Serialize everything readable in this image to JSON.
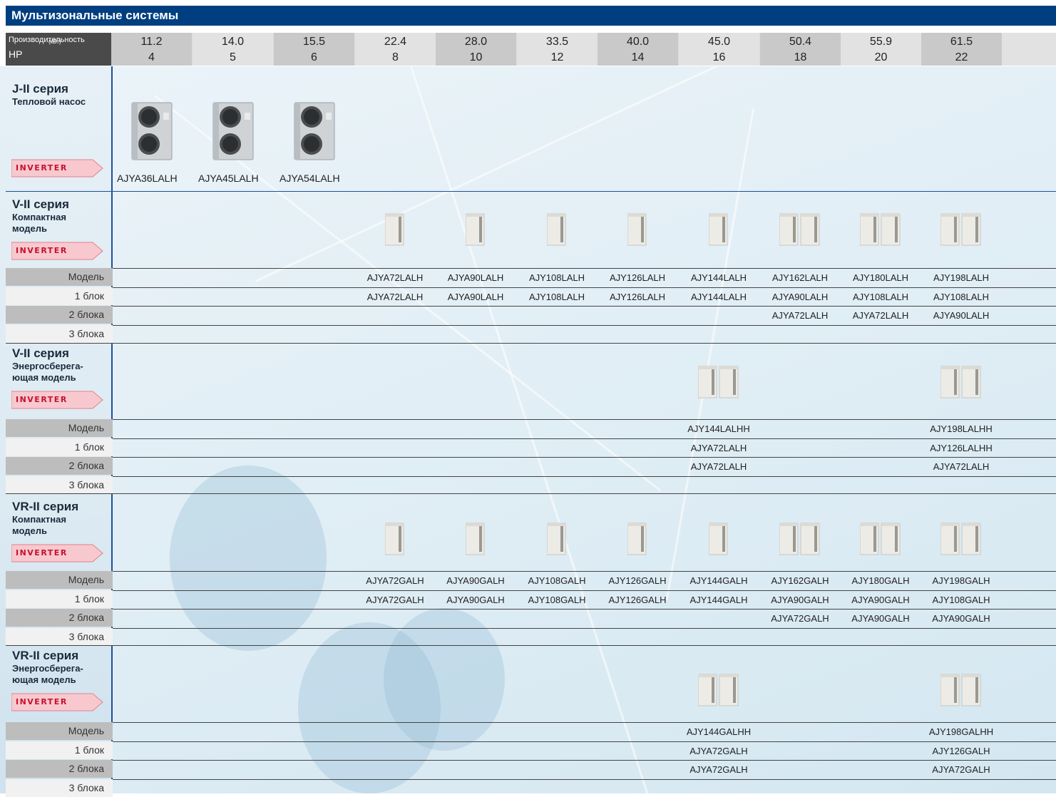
{
  "title": "Мультизональные системы",
  "header": {
    "capacity_label": "Производительность",
    "capacity_unit": "(кВт)",
    "hp_label": "HP",
    "capacity": [
      "11.2",
      "14.0",
      "15.5",
      "22.4",
      "28.0",
      "33.5",
      "40.0",
      "45.0",
      "50.4",
      "55.9",
      "61.5"
    ],
    "hp": [
      "4",
      "5",
      "6",
      "8",
      "10",
      "12",
      "14",
      "16",
      "18",
      "20",
      "22"
    ]
  },
  "colors": {
    "title_bar": "#003f7f",
    "inverter_badge": "#f7c9cf",
    "inverter_text": "#c8102e",
    "divider": "#1f4f99"
  },
  "badge": "INVERTER",
  "row_labels": {
    "model": "Модель",
    "block1": "1 блок",
    "block2": "2 блока",
    "block3": "3 блока"
  },
  "series": [
    {
      "name": "J-II серия",
      "sub1": "Тепловой насос",
      "sub2": "",
      "models": [
        "AJYA36LALH",
        "AJYA45LALH",
        "AJYA54LALH"
      ]
    },
    {
      "name": "V-II серия",
      "sub1": "Компактная",
      "sub2": "модель",
      "model": [
        "",
        "",
        "",
        "AJYA72LALH",
        "AJYA90LALH",
        "AJY108LALH",
        "AJY126LALH",
        "AJY144LALH",
        "AJY162LALH",
        "AJY180LALH",
        "AJY198LALH"
      ],
      "block1": [
        "",
        "",
        "",
        "AJYA72LALH",
        "AJYA90LALH",
        "AJY108LALH",
        "AJY126LALH",
        "AJY144LALH",
        "AJYA90LALH",
        "AJY108LALH",
        "AJY108LALH"
      ],
      "block2": [
        "",
        "",
        "",
        "",
        "",
        "",
        "",
        "",
        "AJYA72LALH",
        "AJYA72LALH",
        "AJYA90LALH"
      ],
      "block3": [
        "",
        "",
        "",
        "",
        "",
        "",
        "",
        "",
        "",
        "",
        ""
      ]
    },
    {
      "name": "V-II серия",
      "sub1": "Энергосберега-",
      "sub2": "ющая модель",
      "model": [
        "",
        "",
        "",
        "",
        "",
        "",
        "",
        "AJY144LALHH",
        "",
        "",
        "AJY198LALHH"
      ],
      "block1": [
        "",
        "",
        "",
        "",
        "",
        "",
        "",
        "AJYA72LALH",
        "",
        "",
        "AJY126LALHH"
      ],
      "block2": [
        "",
        "",
        "",
        "",
        "",
        "",
        "",
        "AJYA72LALH",
        "",
        "",
        "AJYA72LALH"
      ],
      "block3": [
        "",
        "",
        "",
        "",
        "",
        "",
        "",
        "",
        "",
        "",
        ""
      ]
    },
    {
      "name": "VR-II серия",
      "sub1": "Компактная",
      "sub2": "модель",
      "model": [
        "",
        "",
        "",
        "AJYA72GALH",
        "AJYA90GALH",
        "AJY108GALH",
        "AJY126GALH",
        "AJY144GALH",
        "AJY162GALH",
        "AJY180GALH",
        "AJY198GALH"
      ],
      "block1": [
        "",
        "",
        "",
        "AJYA72GALH",
        "AJYA90GALH",
        "AJY108GALH",
        "AJY126GALH",
        "AJY144GALH",
        "AJYA90GALH",
        "AJYA90GALH",
        "AJY108GALH"
      ],
      "block2": [
        "",
        "",
        "",
        "",
        "",
        "",
        "",
        "",
        "AJYA72GALH",
        "AJYA90GALH",
        "AJYA90GALH"
      ],
      "block3": [
        "",
        "",
        "",
        "",
        "",
        "",
        "",
        "",
        "",
        "",
        ""
      ]
    },
    {
      "name": "VR-II серия",
      "sub1": "Энергосберега-",
      "sub2": "ющая модель",
      "model": [
        "",
        "",
        "",
        "",
        "",
        "",
        "",
        "AJY144GALHH",
        "",
        "",
        "AJY198GALHH"
      ],
      "block1": [
        "",
        "",
        "",
        "",
        "",
        "",
        "",
        "AJYA72GALH",
        "",
        "",
        "AJY126GALH"
      ],
      "block2": [
        "",
        "",
        "",
        "",
        "",
        "",
        "",
        "AJYA72GALH",
        "",
        "",
        "AJYA72GALH"
      ],
      "block3": [
        "",
        "",
        "",
        "",
        "",
        "",
        "",
        "",
        "",
        "",
        ""
      ]
    }
  ]
}
